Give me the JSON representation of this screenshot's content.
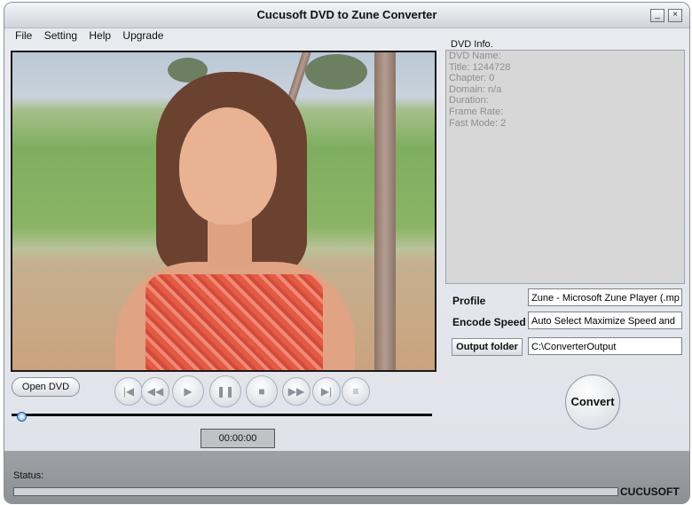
{
  "window": {
    "title": "Cucusoft DVD to Zune Converter"
  },
  "menu": [
    "File",
    "Setting",
    "Help",
    "Upgrade"
  ],
  "dvdinfo": {
    "label": "DVD Info.",
    "lines": [
      "DVD Name:",
      "Title: 1244728",
      "Chapter: 0",
      "Domain: n/a",
      "Duration:",
      "Frame Rate:",
      "Fast Mode: 2"
    ]
  },
  "settings": {
    "profile_label": "Profile",
    "profile_value": "Zune - Microsoft Zune Player (.mp",
    "encode_label": "Encode Speed",
    "encode_value": "Auto Select Maximize Speed and",
    "output_label": "Output folder",
    "output_value": "C:\\ConverterOutput"
  },
  "controls": {
    "open_label": "Open DVD",
    "time": "00:00:00",
    "convert_label": "Convert"
  },
  "status": {
    "label": "Status:",
    "brand": "CUCUSOFT"
  },
  "icons": {
    "minimize": "minimize-icon",
    "close": "close-icon",
    "first": "skip-first-icon",
    "rewind": "rewind-icon",
    "play": "play-icon",
    "pause": "pause-icon",
    "stop": "stop-icon",
    "forward": "fast-forward-icon",
    "last": "skip-last-icon",
    "menu": "menu-list-icon"
  }
}
